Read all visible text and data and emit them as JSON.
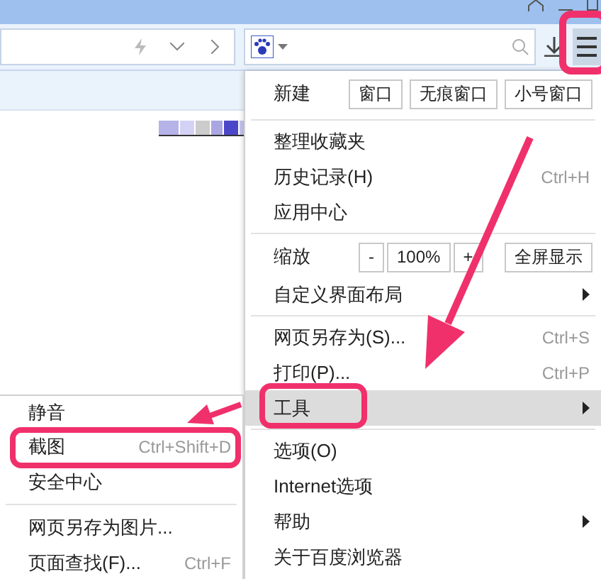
{
  "main_menu": [
    {
      "kind": "new",
      "label": "新建",
      "buttons": [
        "窗口",
        "无痕窗口",
        "小号窗口"
      ]
    },
    {
      "kind": "divider"
    },
    {
      "kind": "item",
      "label": "整理收藏夹",
      "submenu": false,
      "selected": false
    },
    {
      "kind": "item",
      "label": "历史记录(H)",
      "shortcut": "Ctrl+H",
      "submenu": false,
      "selected": false
    },
    {
      "kind": "item",
      "label": "应用中心",
      "submenu": false,
      "selected": false
    },
    {
      "kind": "divider"
    },
    {
      "kind": "zoom",
      "label": "缩放",
      "minus": "-",
      "value": "100%",
      "plus": "+",
      "fullscreen": "全屏显示"
    },
    {
      "kind": "item",
      "label": "自定义界面布局",
      "submenu": true,
      "selected": false
    },
    {
      "kind": "divider"
    },
    {
      "kind": "item",
      "label": "网页另存为(S)...",
      "shortcut": "Ctrl+S",
      "submenu": false,
      "selected": false
    },
    {
      "kind": "item",
      "label": "打印(P)...",
      "shortcut": "Ctrl+P",
      "submenu": false,
      "selected": false
    },
    {
      "kind": "item",
      "label": "工具",
      "submenu": true,
      "selected": true
    },
    {
      "kind": "divider"
    },
    {
      "kind": "item",
      "label": "选项(O)",
      "submenu": false,
      "selected": false
    },
    {
      "kind": "item",
      "label": "Internet选项",
      "submenu": false,
      "selected": false
    },
    {
      "kind": "item",
      "label": "帮助",
      "submenu": true,
      "selected": false
    },
    {
      "kind": "item",
      "label": "关于百度浏览器",
      "submenu": false,
      "selected": false
    }
  ],
  "tools_submenu": [
    {
      "kind": "item",
      "label": "静音",
      "selected": false
    },
    {
      "kind": "item",
      "label": "截图",
      "shortcut": "Ctrl+Shift+D",
      "selected": false
    },
    {
      "kind": "item",
      "label": "安全中心",
      "selected": false
    },
    {
      "kind": "divider"
    },
    {
      "kind": "item",
      "label": "网页另存为图片...",
      "selected": false
    },
    {
      "kind": "item",
      "label": "页面查找(F)...",
      "shortcut": "Ctrl+F",
      "selected": false
    }
  ]
}
